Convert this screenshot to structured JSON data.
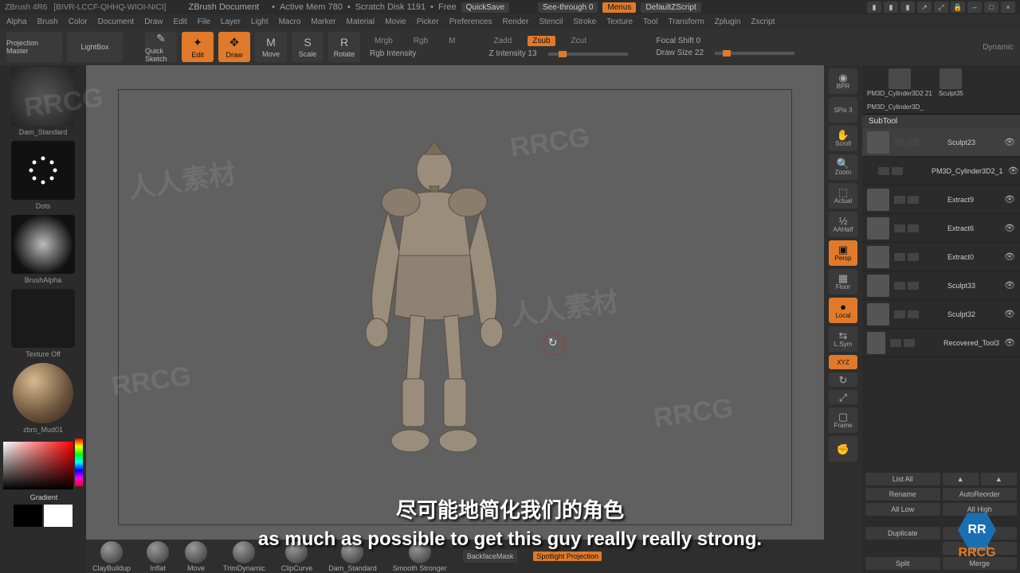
{
  "title": {
    "app": "ZBrush 4R6",
    "doc": "[BIVR-LCCF-QHHQ-WIOI-NICI]",
    "doc_label": "ZBrush Document",
    "mem": "Active Mem 780",
    "scratch": "Scratch Disk 1191",
    "free": "Free",
    "quicksave": "QuickSave",
    "seethrough": "See-through  0",
    "menus": "Menus",
    "zscript": "DefaultZScript"
  },
  "menubar": [
    "Alpha",
    "Brush",
    "Color",
    "Document",
    "Draw",
    "Edit",
    "File",
    "Layer",
    "Light",
    "Macro",
    "Marker",
    "Material",
    "Movie",
    "Picker",
    "Preferences",
    "Render",
    "Stencil",
    "Stroke",
    "Texture",
    "Tool",
    "Transform",
    "Zplugin",
    "Zscript"
  ],
  "toolbar": {
    "projection": "Projection Master",
    "lightbox": "LightBox",
    "quicksketch": "Quick Sketch",
    "edit": "Edit",
    "draw": "Draw",
    "move": "Move",
    "scale": "Scale",
    "rotate": "Rotate",
    "mrgb": "Mrgb",
    "rgb": "Rgb",
    "m": "M",
    "rgb_intensity": "Rgb Intensity",
    "zadd": "Zadd",
    "zsub": "Zsub",
    "zcut": "Zcut",
    "zintensity": "Z Intensity 13",
    "focalshift": "Focal Shift 0",
    "drawsize": "Draw Size 22",
    "dynamic": "Dynamic"
  },
  "left": {
    "brush": "Dam_Standard",
    "stroke": "Dots",
    "alpha": "BrushAlpha",
    "texture": "Texture Off",
    "material": "zbro_Mud01",
    "gradient": "Gradient"
  },
  "right_tools": {
    "bpr": "BPR",
    "spix": "SPix 3",
    "scroll": "Scroll",
    "zoom": "Zoom",
    "actual": "Actual",
    "aahalf": "AAHalf",
    "persp": "Persp",
    "floor": "Floor",
    "local": "Local",
    "lsym": "L.Sym",
    "xyz": "XYZ",
    "frame": "Frame"
  },
  "tools_top": {
    "items": [
      "PM3D_Cylinder3D2 21",
      "Sculpt35",
      "PM3D_Cylinder3D_"
    ]
  },
  "subtool": {
    "header": "SubTool",
    "items": [
      {
        "name": "Sculpt23"
      },
      {
        "name": "PM3D_Cylinder3D2_1"
      },
      {
        "name": "Extract9"
      },
      {
        "name": "Extract6"
      },
      {
        "name": "Extract0"
      },
      {
        "name": "Sculpt33"
      },
      {
        "name": "Sculpt32"
      },
      {
        "name": "Recovered_Tool3"
      }
    ]
  },
  "rp_buttons": {
    "listall": "List All",
    "up": "▲",
    "down": "▲",
    "rename": "Rename",
    "autoreorder": "AutoReorder",
    "alllow": "All Low",
    "allhigh": "All High",
    "duplicate": "Duplicate",
    "append": "Append",
    "insert": "Insert",
    "split": "Split",
    "merge": "Merge"
  },
  "shelf": {
    "items": [
      "ClayBuildup",
      "Inflat",
      "Move",
      "TrimDynamic",
      "ClipCurve",
      "Dam_Standard",
      "Smooth Stronger"
    ],
    "backface": "BackfaceMask",
    "spotlight": "Spotlight Projection"
  },
  "subtitles": {
    "cn": "尽可能地简化我们的角色",
    "en": "as much as possible to get this guy really really strong."
  },
  "watermarks": {
    "w1": "人人素材",
    "w2": "RRCG",
    "w3": "人人素材",
    "w4": "RRCG",
    "w5": "人人素材",
    "w6": "RRCG",
    "w7": "人人素材",
    "w8": "RRCG"
  },
  "logo": {
    "hex": "RR",
    "txt": "RRCG"
  }
}
